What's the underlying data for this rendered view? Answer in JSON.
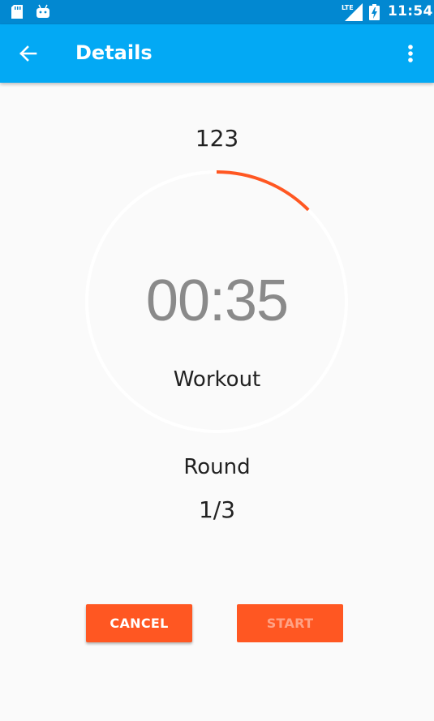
{
  "status_bar": {
    "time": "11:54",
    "network_label": "LTE",
    "icons": [
      "sd-card-icon",
      "android-icon",
      "signal-icon",
      "battery-charging-icon"
    ]
  },
  "app_bar": {
    "title": "Details",
    "back_icon": "arrow-back-icon",
    "menu_icon": "more-vert-icon"
  },
  "workout": {
    "counter": "123",
    "timer": "00:35",
    "phase": "Workout",
    "progress_fraction": 0.125
  },
  "round": {
    "label": "Round",
    "value": "1/3"
  },
  "actions": {
    "cancel_label": "CANCEL",
    "start_label": "START"
  },
  "colors": {
    "status_bar": "#0288d1",
    "app_bar": "#03a9f4",
    "accent": "#ff5722",
    "background": "#fafafa",
    "ring_track": "#ffffff"
  }
}
